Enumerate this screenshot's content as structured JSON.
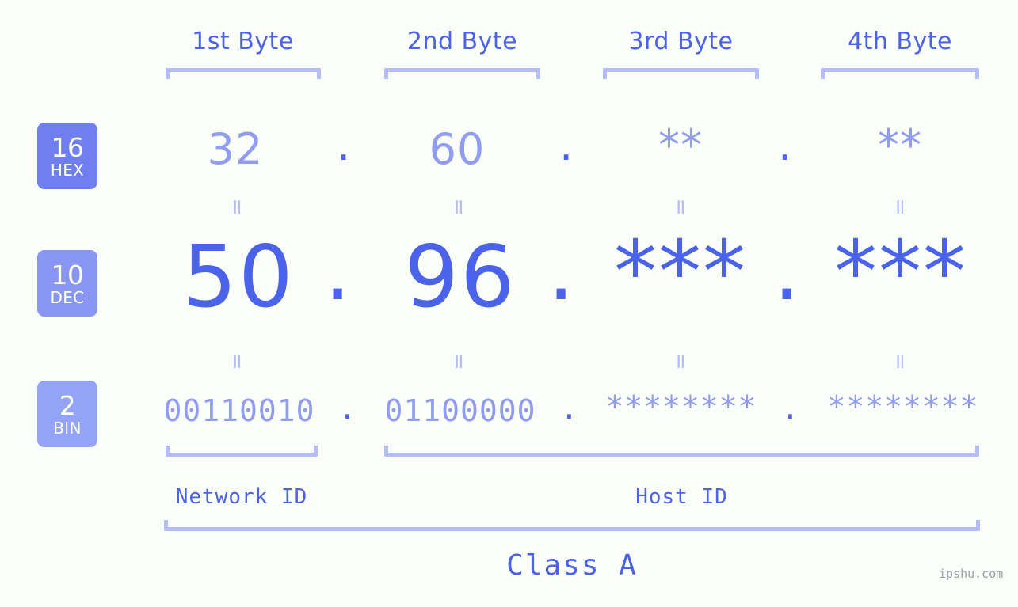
{
  "background_color": "#fbfdf8",
  "accent_colors": {
    "strong_blue": "#4b63e8",
    "mid_blue": "#8f9cf0",
    "light_blue": "#b4bdf7",
    "badge_hex": "#6f7ff0",
    "badge_dec": "#8a97f2",
    "badge_bin": "#93a4f7"
  },
  "byte_headers": [
    {
      "label": "1st Byte"
    },
    {
      "label": "2nd Byte"
    },
    {
      "label": "3rd Byte"
    },
    {
      "label": "4th Byte"
    }
  ],
  "rows": [
    {
      "badge_number": "16",
      "badge_system": "HEX",
      "values": [
        "32",
        "60",
        "**",
        "**"
      ],
      "separator": "."
    },
    {
      "badge_number": "10",
      "badge_system": "DEC",
      "values": [
        "50",
        "96",
        "***",
        "***"
      ],
      "separator": "."
    },
    {
      "badge_number": "2",
      "badge_system": "BIN",
      "values": [
        "00110010",
        "01100000",
        "********",
        "********"
      ],
      "separator": "."
    }
  ],
  "equals_glyph": "=",
  "footer": {
    "network_id_label": "Network ID",
    "host_id_label": "Host ID",
    "class_label": "Class A",
    "watermark": "ipshu.com"
  }
}
